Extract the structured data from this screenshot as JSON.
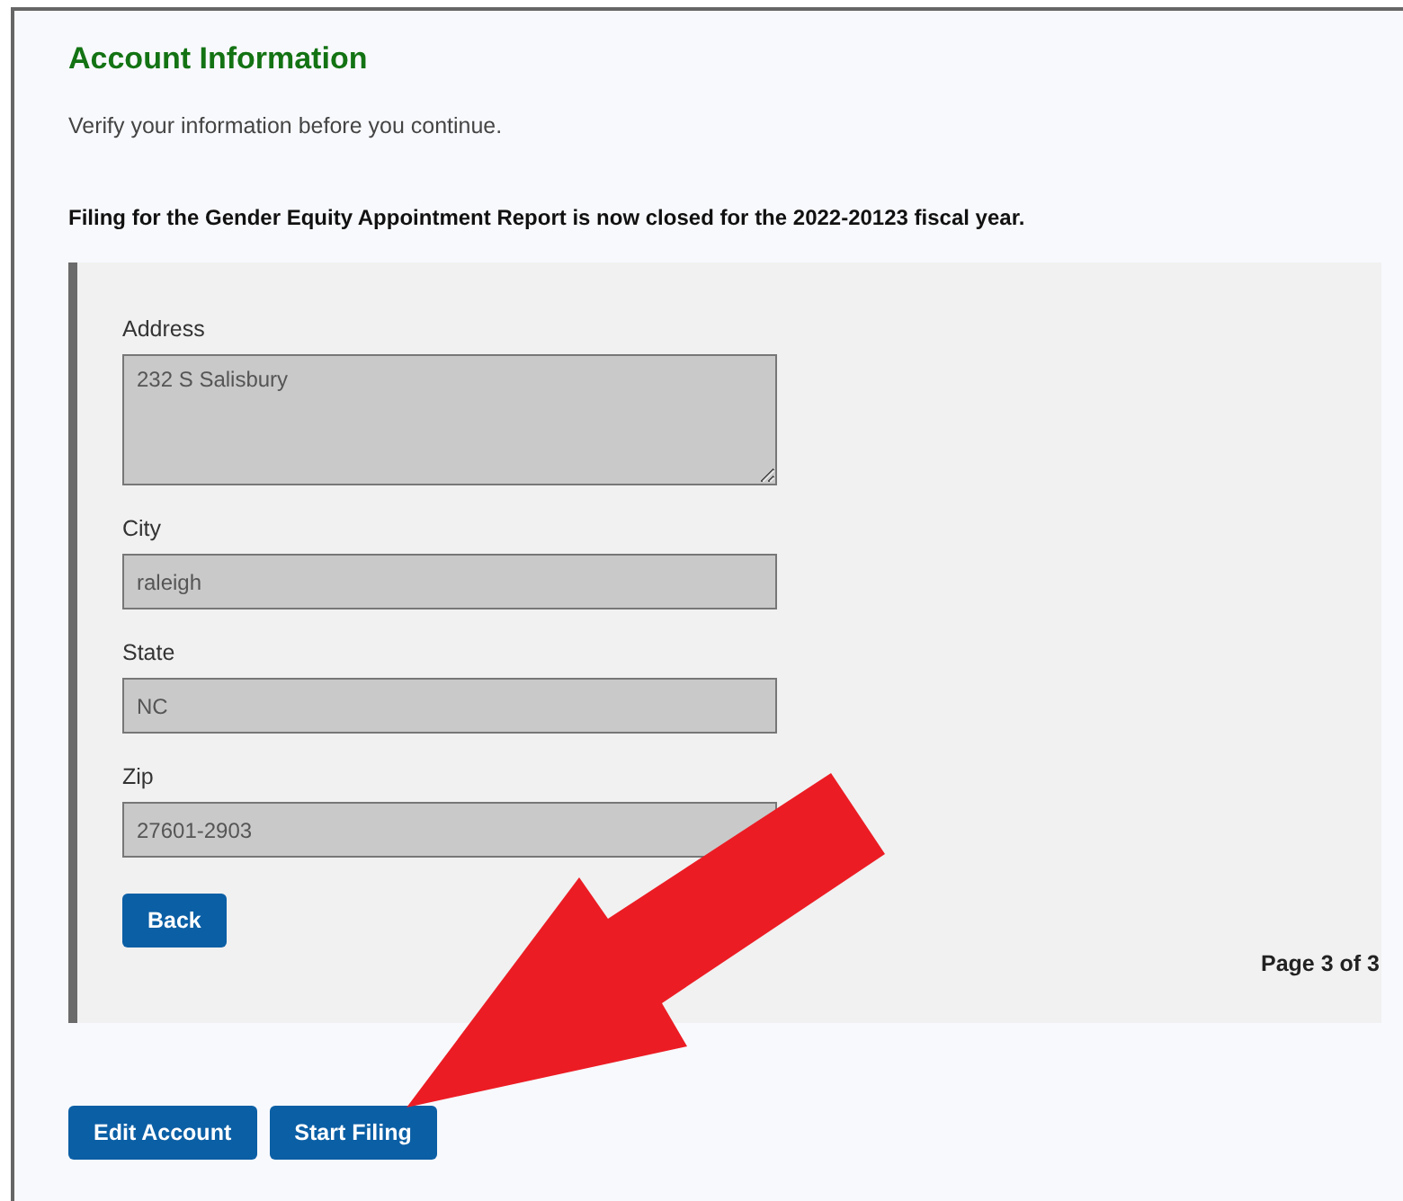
{
  "title": "Account Information",
  "intro": "Verify your information before you continue.",
  "notice": "Filing for the Gender Equity Appointment Report is now closed for the 2022-20123 fiscal year.",
  "form": {
    "fields": [
      {
        "kind": "textarea",
        "label": "Address",
        "value": "232 S Salisbury",
        "disabled": true
      },
      {
        "kind": "input",
        "label": "City",
        "value": "raleigh",
        "disabled": true
      },
      {
        "kind": "input",
        "label": "State",
        "value": "NC",
        "disabled": true
      },
      {
        "kind": "input",
        "label": "Zip",
        "value": "27601-2903",
        "disabled": true
      }
    ],
    "back_button": "Back",
    "page_indicator": "Page 3 of 3"
  },
  "buttons": [
    "Edit Account",
    "Start Filing"
  ]
}
